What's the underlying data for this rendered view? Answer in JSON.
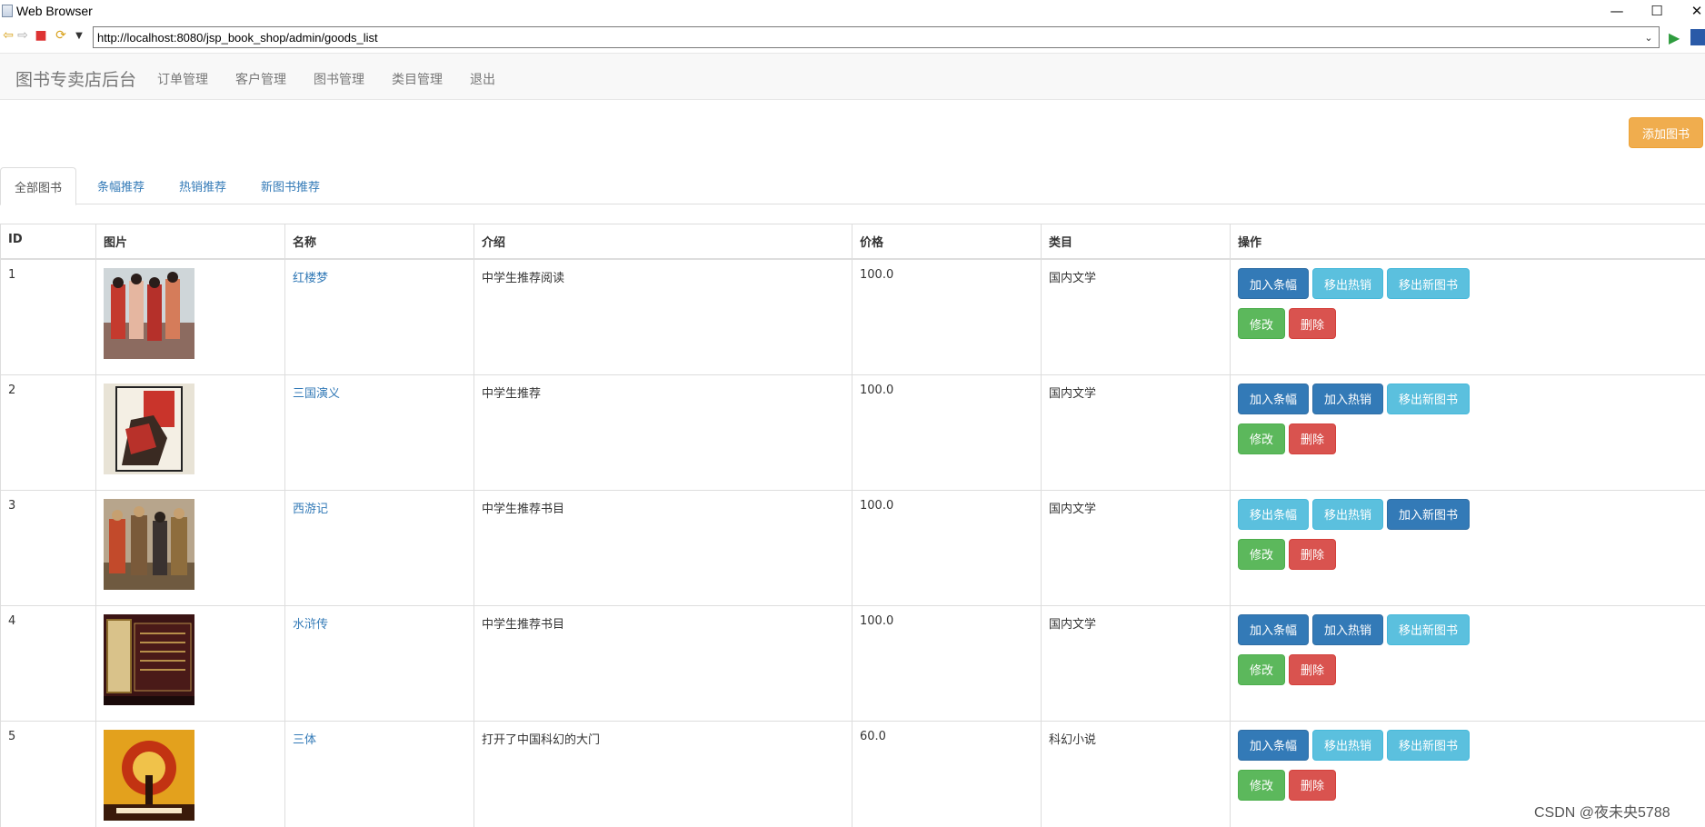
{
  "window": {
    "title": "Web Browser",
    "controls": {
      "minimize": "—",
      "maximize": "☐",
      "close": "✕"
    }
  },
  "browser": {
    "url": "http://localhost:8080/jsp_book_shop/admin/goods_list"
  },
  "navbar": {
    "brand": "图书专卖店后台",
    "items": [
      "订单管理",
      "客户管理",
      "图书管理",
      "类目管理",
      "退出"
    ]
  },
  "actions": {
    "add_book": "添加图书"
  },
  "tabs": [
    "全部图书",
    "条幅推荐",
    "热销推荐",
    "新图书推荐"
  ],
  "table": {
    "headers": [
      "ID",
      "图片",
      "名称",
      "介绍",
      "价格",
      "类目",
      "操作"
    ],
    "rows": [
      {
        "id": "1",
        "name": "红楼梦",
        "intro": "中学生推荐阅读",
        "price": "100.0",
        "category": "国内文学",
        "buttons": [
          {
            "label": "加入条幅",
            "style": "primary"
          },
          {
            "label": "移出热销",
            "style": "info"
          },
          {
            "label": "移出新图书",
            "style": "info"
          }
        ]
      },
      {
        "id": "2",
        "name": "三国演义",
        "intro": "中学生推荐",
        "price": "100.0",
        "category": "国内文学",
        "buttons": [
          {
            "label": "加入条幅",
            "style": "primary"
          },
          {
            "label": "加入热销",
            "style": "primary"
          },
          {
            "label": "移出新图书",
            "style": "info"
          }
        ]
      },
      {
        "id": "3",
        "name": "西游记",
        "intro": "中学生推荐书目",
        "price": "100.0",
        "category": "国内文学",
        "buttons": [
          {
            "label": "移出条幅",
            "style": "info"
          },
          {
            "label": "移出热销",
            "style": "info"
          },
          {
            "label": "加入新图书",
            "style": "primary"
          }
        ]
      },
      {
        "id": "4",
        "name": "水浒传",
        "intro": "中学生推荐书目",
        "price": "100.0",
        "category": "国内文学",
        "buttons": [
          {
            "label": "加入条幅",
            "style": "primary"
          },
          {
            "label": "加入热销",
            "style": "primary"
          },
          {
            "label": "移出新图书",
            "style": "info"
          }
        ]
      },
      {
        "id": "5",
        "name": "三体",
        "intro": "打开了中国科幻的大门",
        "price": "60.0",
        "category": "科幻小说",
        "buttons": [
          {
            "label": "加入条幅",
            "style": "primary"
          },
          {
            "label": "移出热销",
            "style": "info"
          },
          {
            "label": "移出新图书",
            "style": "info"
          }
        ]
      }
    ],
    "row_actions": {
      "edit": "修改",
      "delete": "删除"
    }
  },
  "watermark": "CSDN @夜未央5788",
  "colors": {
    "primary": "#337ab7",
    "info": "#5bc0de",
    "success": "#5cb85c",
    "danger": "#d9534f",
    "warning": "#f0ad4e"
  }
}
